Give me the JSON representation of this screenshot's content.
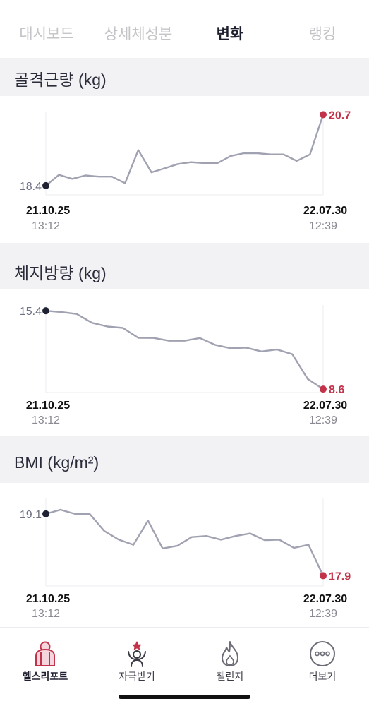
{
  "tabs": [
    {
      "label": "대시보드",
      "active": false
    },
    {
      "label": "상세체성분",
      "active": false
    },
    {
      "label": "변화",
      "active": true
    },
    {
      "label": "랭킹",
      "active": false
    }
  ],
  "colors": {
    "line": "#a1a2b1",
    "start_dot": "#1f2233",
    "end_dot": "#c2334a",
    "start_label": "#6e7086",
    "end_label": "#c2334a"
  },
  "sections": [
    {
      "title": "골격근량 (kg)",
      "start_label": "18.4",
      "end_label": "20.7",
      "start_date": "21.10.25",
      "start_time": "13:12",
      "end_date": "22.07.30",
      "end_time": "12:39"
    },
    {
      "title": "체지방량 (kg)",
      "start_label": "15.4",
      "end_label": "8.6",
      "start_date": "21.10.25",
      "start_time": "13:12",
      "end_date": "22.07.30",
      "end_time": "12:39"
    },
    {
      "title": "BMI (kg/m²)",
      "start_label": "19.1",
      "end_label": "17.9",
      "start_date": "21.10.25",
      "start_time": "13:12",
      "end_date": "22.07.30",
      "end_time": "12:39"
    }
  ],
  "chart_data": [
    {
      "type": "line",
      "title": "골격근량 (kg)",
      "y": [
        18.4,
        18.75,
        18.62,
        18.73,
        18.69,
        18.69,
        18.48,
        19.55,
        18.83,
        18.96,
        19.1,
        19.16,
        19.13,
        19.13,
        19.36,
        19.45,
        19.45,
        19.41,
        19.41,
        19.2,
        19.41,
        20.7
      ],
      "ylim": [
        18.1,
        20.8
      ]
    },
    {
      "type": "line",
      "title": "체지방량 (kg)",
      "y": [
        15.4,
        15.29,
        15.12,
        14.35,
        14.03,
        13.91,
        13.05,
        13.04,
        12.79,
        12.79,
        13.03,
        12.43,
        12.14,
        12.2,
        11.87,
        12.04,
        11.63,
        9.47,
        8.6
      ],
      "ylim": [
        8.3,
        15.9
      ]
    },
    {
      "type": "line",
      "title": "BMI (kg/m²)",
      "y": [
        19.1,
        19.18,
        19.1,
        19.1,
        18.77,
        18.6,
        18.5,
        18.97,
        18.43,
        18.48,
        18.65,
        18.67,
        18.6,
        18.67,
        18.72,
        18.59,
        18.6,
        18.44,
        18.5,
        17.9
      ],
      "ylim": [
        17.7,
        19.4
      ]
    }
  ],
  "nav": [
    {
      "label": "헬스리포트",
      "icon": "health-report-icon",
      "active": true
    },
    {
      "label": "자극받기",
      "icon": "motivation-icon",
      "active": false
    },
    {
      "label": "챌린지",
      "icon": "flame-icon",
      "active": false
    },
    {
      "label": "더보기",
      "icon": "more-dots-icon",
      "active": false
    }
  ]
}
